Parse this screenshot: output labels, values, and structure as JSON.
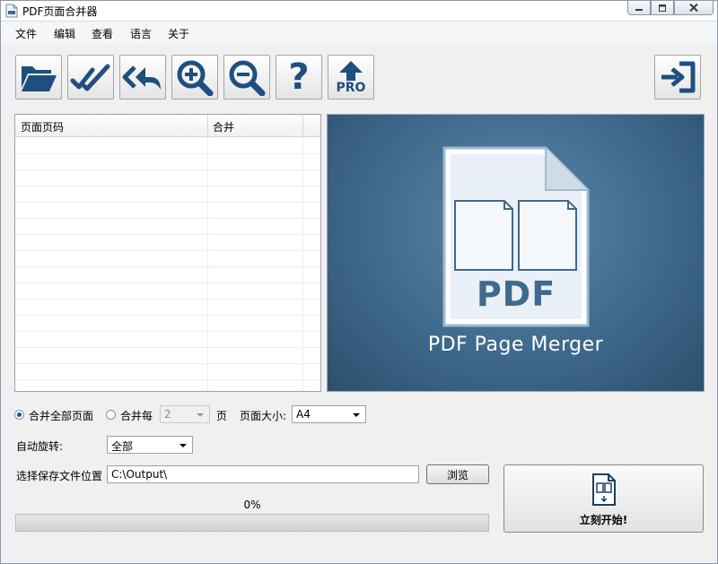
{
  "window": {
    "title": "PDF页面合并器"
  },
  "menu": [
    "文件",
    "编辑",
    "查看",
    "语言",
    "关于"
  ],
  "toolbar": {
    "pro_label": "PRO",
    "help_glyph": "?"
  },
  "list": {
    "columns": [
      "页面页码",
      "合并"
    ],
    "rows": []
  },
  "preview": {
    "doc_label": "PDF",
    "brand": "PDF Page Merger"
  },
  "options": {
    "merge_all_label": "合并全部页面",
    "merge_each_label": "合并每",
    "merge_each_value": "2",
    "pages_unit": "页",
    "page_size_label": "页面大小:",
    "page_size_value": "A4",
    "merge_mode": "all",
    "auto_rotate_label": "自动旋转:",
    "auto_rotate_value": "全部"
  },
  "output": {
    "label": "选择保存文件位置",
    "path": "C:\\Output\\",
    "browse_label": "浏览"
  },
  "progress": {
    "text": "0%",
    "value": 0
  },
  "start": {
    "label": "立刻开始!"
  },
  "colors": {
    "preview_bg": "#3f6a8c",
    "progress_fill": "#06b025",
    "radio_dot": "#1b4ea3"
  }
}
